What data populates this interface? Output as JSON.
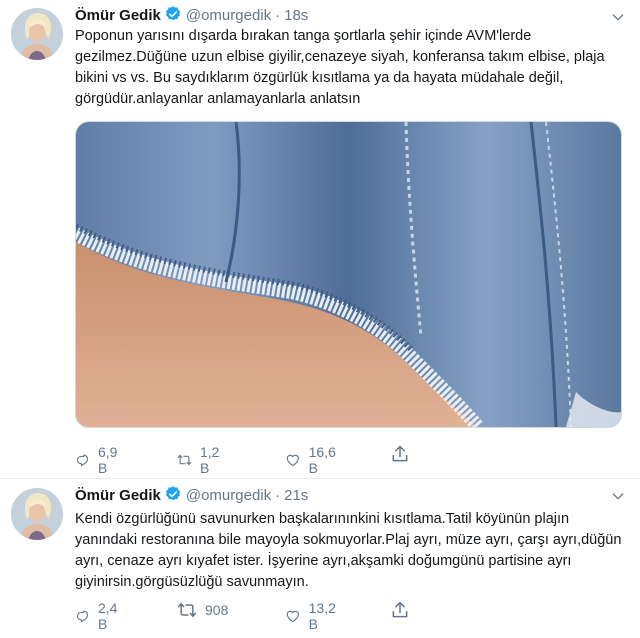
{
  "tweets": [
    {
      "name": "Ömür Gedik",
      "handle": "@omurgedik",
      "time": "18s",
      "text": "Poponun yarısını dışarda bırakan tanga şortlarla şehir içinde AVM'lerde gezilmez.Düğüne uzun elbise giyilir,cenazeye siyah, konferansa takım elbise, plaja bikini vs vs. Bu saydıklarım özgürlük kısıtlama ya da hayata müdahale değil, görgüdür.anlayanlar anlamayanlarla anlatsın",
      "replies": "6,9 B",
      "retweets": "1,2 B",
      "likes": "16,6 B"
    },
    {
      "name": "Ömür Gedik",
      "handle": "@omurgedik",
      "time": "21s",
      "text": "Kendi özgürlüğünü savunurken başkalarınınkini kısıtlama.Tatil köyünün plajın yanındaki restoranına bile mayoyla sokmuyorlar.Plaj ayrı, müze ayrı, çarşı ayrı,düğün ayrı, cenaze ayrı kıyafet ister.  İşyerine ayrı,akşamki doğumgünü partisine ayrı giyinirsin.görgüsüzlüğü savunmayın.",
      "replies": "2,4 B",
      "retweets": "908",
      "likes": "13,2 B"
    }
  ],
  "colors": {
    "text": "#14171a",
    "secondary": "#657786",
    "verified": "#1da1f2",
    "divider": "#e6ecf0"
  },
  "icons": [
    "avatar",
    "verified-badge-icon",
    "chevron-down-icon",
    "reply-icon",
    "retweet-icon",
    "like-icon",
    "share-icon"
  ]
}
